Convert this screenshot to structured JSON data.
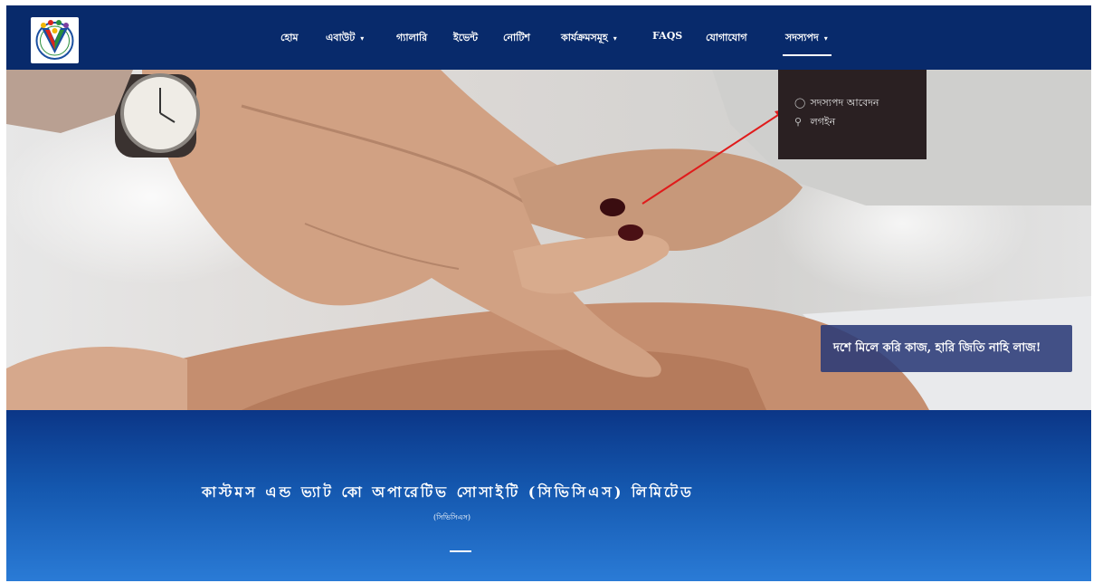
{
  "nav": {
    "items": [
      {
        "label": "হোম"
      },
      {
        "label": "এবাউট",
        "caret": "▾"
      },
      {
        "label": "গ্যালারি"
      },
      {
        "label": "ইভেন্ট"
      },
      {
        "label": "নোটিশ"
      },
      {
        "label": "কার্যক্রমসমূহ",
        "caret": "▾"
      },
      {
        "label": "FAQS"
      },
      {
        "label": "যোগাযোগ"
      },
      {
        "label": "সদস্যপদ",
        "caret": "▾"
      }
    ],
    "active_item": "সদস্যপদ"
  },
  "membership_dropdown": {
    "items": [
      {
        "icon": "user-icon",
        "label": "সদস্যপদ আবেদন"
      },
      {
        "icon": "key-icon",
        "label": "লগইন"
      }
    ]
  },
  "hero": {
    "tagline": "দশে মিলে করি কাজ, হারি জিতি নাহি লাজ!"
  },
  "org": {
    "title": "কাস্টমস এন্ড ভ্যাট কো অপারেটিভ সোসাইটি (সিভিসিএস) লিমিটেড",
    "short_name": "(সিভিসিএস)"
  },
  "colors": {
    "nav_bg": "#082a6b",
    "dropdown_bg": "#2a2022",
    "tagline_bg": "#2a3a78",
    "annotation_arrow": "#e01b1b",
    "lower_gradient_top": "#0b3687",
    "lower_gradient_bottom": "#2a7bd6"
  }
}
